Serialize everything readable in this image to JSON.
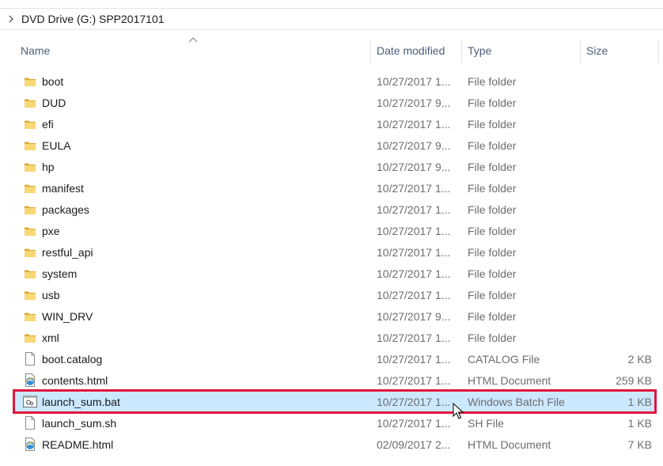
{
  "breadcrumb": {
    "path": "DVD Drive (G:) SPP2017101"
  },
  "columns": {
    "name": "Name",
    "date": "Date modified",
    "type": "Type",
    "size": "Size"
  },
  "colors": {
    "folder": "#f2c24b",
    "selection_bg": "#cce8ff",
    "highlight_border": "#e0163e",
    "header_text": "#4c607a"
  },
  "files": [
    {
      "name": "boot",
      "date": "10/27/2017 1...",
      "type": "File folder",
      "size": "",
      "icon": "folder-icon"
    },
    {
      "name": "DUD",
      "date": "10/27/2017 9...",
      "type": "File folder",
      "size": "",
      "icon": "folder-icon"
    },
    {
      "name": "efi",
      "date": "10/27/2017 1...",
      "type": "File folder",
      "size": "",
      "icon": "folder-icon"
    },
    {
      "name": "EULA",
      "date": "10/27/2017 9...",
      "type": "File folder",
      "size": "",
      "icon": "folder-icon"
    },
    {
      "name": "hp",
      "date": "10/27/2017 9...",
      "type": "File folder",
      "size": "",
      "icon": "folder-icon"
    },
    {
      "name": "manifest",
      "date": "10/27/2017 1...",
      "type": "File folder",
      "size": "",
      "icon": "folder-icon"
    },
    {
      "name": "packages",
      "date": "10/27/2017 1...",
      "type": "File folder",
      "size": "",
      "icon": "folder-icon"
    },
    {
      "name": "pxe",
      "date": "10/27/2017 1...",
      "type": "File folder",
      "size": "",
      "icon": "folder-icon"
    },
    {
      "name": "restful_api",
      "date": "10/27/2017 1...",
      "type": "File folder",
      "size": "",
      "icon": "folder-icon"
    },
    {
      "name": "system",
      "date": "10/27/2017 1...",
      "type": "File folder",
      "size": "",
      "icon": "folder-icon"
    },
    {
      "name": "usb",
      "date": "10/27/2017 1...",
      "type": "File folder",
      "size": "",
      "icon": "folder-icon"
    },
    {
      "name": "WIN_DRV",
      "date": "10/27/2017 9...",
      "type": "File folder",
      "size": "",
      "icon": "folder-icon"
    },
    {
      "name": "xml",
      "date": "10/27/2017 1...",
      "type": "File folder",
      "size": "",
      "icon": "folder-icon"
    },
    {
      "name": "boot.catalog",
      "date": "10/27/2017 1...",
      "type": "CATALOG File",
      "size": "2 KB",
      "icon": "file-icon"
    },
    {
      "name": "contents.html",
      "date": "10/27/2017 1...",
      "type": "HTML Document",
      "size": "259 KB",
      "icon": "html-document-icon"
    },
    {
      "name": "launch_sum.bat",
      "date": "10/27/2017 1...",
      "type": "Windows Batch File",
      "size": "1 KB",
      "icon": "batch-file-icon",
      "selected": true
    },
    {
      "name": "launch_sum.sh",
      "date": "10/27/2017 1...",
      "type": "SH File",
      "size": "1 KB",
      "icon": "file-icon"
    },
    {
      "name": "README.html",
      "date": "02/09/2017 2...",
      "type": "HTML Document",
      "size": "7 KB",
      "icon": "html-document-icon"
    }
  ]
}
